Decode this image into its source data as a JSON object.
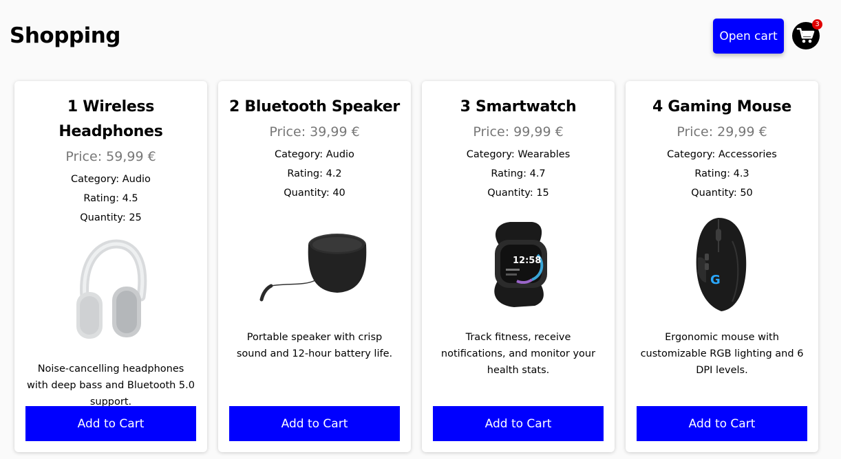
{
  "header": {
    "title": "Shopping",
    "open_cart_label": "Open cart",
    "cart_count": "3"
  },
  "colors": {
    "primary": "#0000ff",
    "badge": "#e10000",
    "price": "#777777"
  },
  "products": [
    {
      "title": "1 Wireless Headphones",
      "price": "Price: 59,99 €",
      "category": "Category: Audio",
      "rating": "Rating: 4.5",
      "quantity": "Quantity: 25",
      "image_icon": "headphones-image",
      "description": "Noise-cancelling headphones with deep bass and Bluetooth 5.0 support.",
      "button": "Add to Cart"
    },
    {
      "title": "2 Bluetooth Speaker",
      "price": "Price: 39,99 €",
      "category": "Category: Audio",
      "rating": "Rating: 4.2",
      "quantity": "Quantity: 40",
      "image_icon": "speaker-image",
      "description": "Portable speaker with crisp sound and 12-hour battery life.",
      "button": "Add to Cart"
    },
    {
      "title": "3 Smartwatch",
      "price": "Price: 99,99 €",
      "category": "Category: Wearables",
      "rating": "Rating: 4.7",
      "quantity": "Quantity: 15",
      "image_icon": "smartwatch-image",
      "watch_time": "12:58",
      "description": "Track fitness, receive notifications, and monitor your health stats.",
      "button": "Add to Cart"
    },
    {
      "title": "4 Gaming Mouse",
      "price": "Price: 29,99 €",
      "category": "Category: Accessories",
      "rating": "Rating: 4.3",
      "quantity": "Quantity: 50",
      "image_icon": "gaming-mouse-image",
      "description": "Ergonomic mouse with customizable RGB lighting and 6 DPI levels.",
      "button": "Add to Cart"
    }
  ]
}
